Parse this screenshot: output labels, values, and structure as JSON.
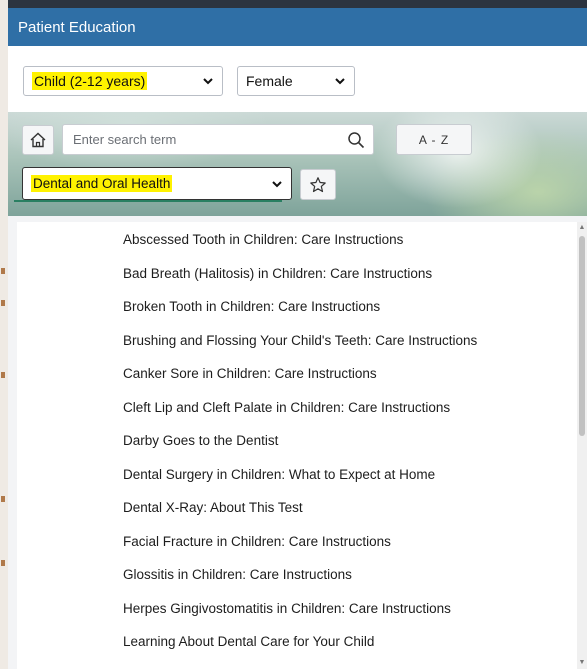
{
  "window": {
    "title": "Patient Education"
  },
  "filters": {
    "age_group": "Child (2-12 years)",
    "sex": "Female"
  },
  "search": {
    "placeholder": "Enter search term",
    "az_label": "A - Z",
    "category": "Dental and Oral Health"
  },
  "icons": {
    "home": "home-icon",
    "search": "search-icon",
    "favorite": "star-icon",
    "dropdown": "chevron-down-icon"
  },
  "colors": {
    "titlebar": "#2f6fa6",
    "highlight": "#fff200",
    "accent": "#2a7f62"
  },
  "articles": [
    "Abscessed Tooth in Children: Care Instructions",
    "Bad Breath (Halitosis) in Children: Care Instructions",
    "Broken Tooth in Children: Care Instructions",
    "Brushing and Flossing Your Child's Teeth: Care Instructions",
    "Canker Sore in Children: Care Instructions",
    "Cleft Lip and Cleft Palate in Children: Care Instructions",
    "Darby Goes to the Dentist",
    "Dental Surgery in Children: What to Expect at Home",
    "Dental X-Ray: About This Test",
    "Facial Fracture in Children: Care Instructions",
    "Glossitis in Children: Care Instructions",
    "Herpes Gingivostomatitis in Children: Care Instructions",
    "Learning About Dental Care for Your Child"
  ]
}
